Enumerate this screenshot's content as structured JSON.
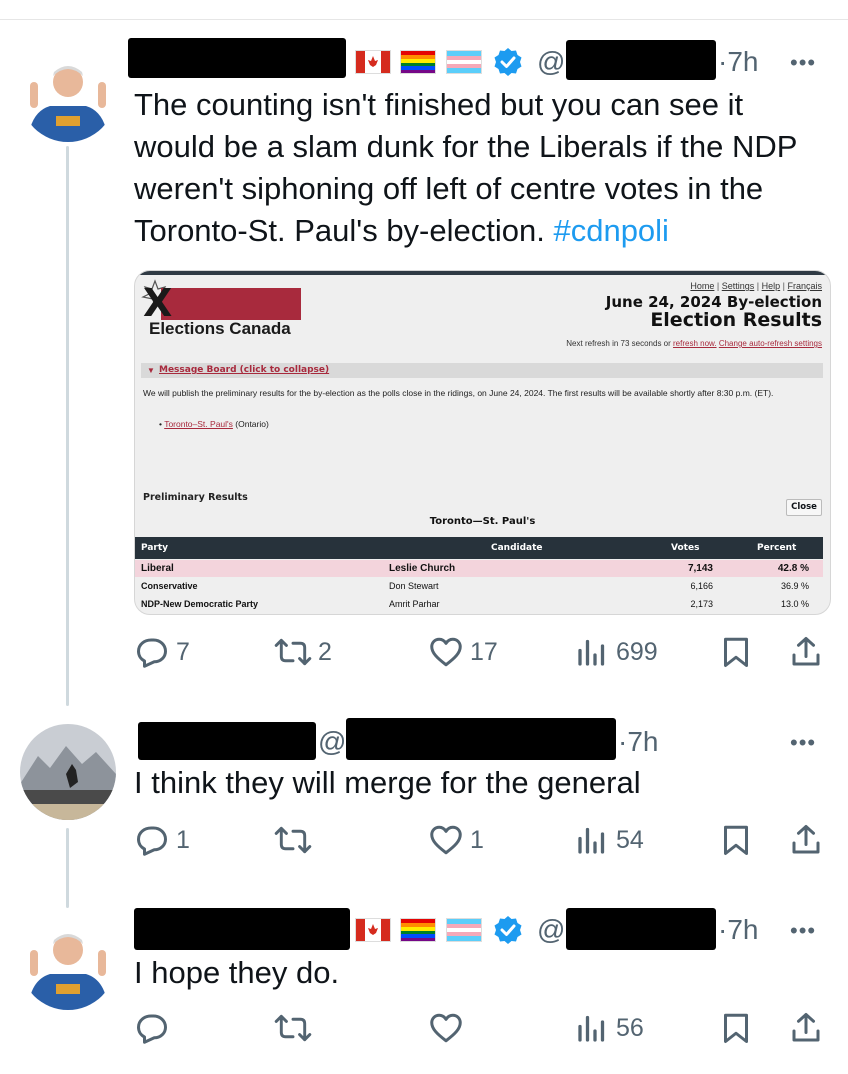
{
  "tweets": [
    {
      "time": "7h",
      "handle_prefix": "@",
      "more": "•••",
      "text_main": "The counting isn't finished but you can see it would be a slam dunk for the Liberals if the NDP weren't siphoning off left of centre votes in the Toronto-St. Paul's by-election.",
      "hashtag": "#cdnpoli",
      "replies": "7",
      "reposts": "2",
      "likes": "17",
      "views": "699"
    },
    {
      "time": "7h",
      "handle_prefix": "@",
      "more": "•••",
      "text": "I think they will merge for the general",
      "replies": "1",
      "reposts": "",
      "likes": "1",
      "views": "54"
    },
    {
      "time": "7h",
      "handle_prefix": "@",
      "more": "•••",
      "text": "I hope they do.",
      "replies": "",
      "reposts": "",
      "likes": "",
      "views": "56"
    }
  ],
  "embed": {
    "logo_text": "Elections Canada",
    "nav": [
      "Home",
      "Settings",
      "Help",
      "Français"
    ],
    "date_title": "June 24, 2024 By-election",
    "results_title": "Election Results",
    "refresh_prefix": "Next refresh in 73 seconds or",
    "refresh_now": "refresh now.",
    "refresh_change": "Change auto-refresh settings",
    "message_board": "Message Board (click to collapse)",
    "message": "We will publish the preliminary results for the by-election as the polls close in the ridings, on June 24, 2024. The first results will be available shortly after 8:30 p.m. (ET).",
    "riding_link": "Toronto–St. Paul's",
    "riding_province": "(Ontario)",
    "prelim_label": "Preliminary Results",
    "close_label": "Close",
    "riding_title": "Toronto—St. Paul's",
    "headers": {
      "party": "Party",
      "candidate": "Candidate",
      "votes": "Votes",
      "percent": "Percent"
    },
    "rows": [
      {
        "party": "Liberal",
        "candidate": "Leslie Church",
        "votes": "7,143",
        "percent": "42.8 %"
      },
      {
        "party": "Conservative",
        "candidate": "Don Stewart",
        "votes": "6,166",
        "percent": "36.9 %"
      },
      {
        "party": "NDP-New Democratic Party",
        "candidate": "Amrit Parhar",
        "votes": "2,173",
        "percent": "13.0 %"
      }
    ]
  },
  "colors": {
    "hashtag": "#1d9bf0",
    "verified": "#1d9bf0",
    "ec_red": "#a82a3d",
    "action_gray": "#536471"
  },
  "icons": [
    "reply-icon",
    "repost-icon",
    "like-icon",
    "views-icon",
    "bookmark-icon",
    "share-icon",
    "verified-icon",
    "canada-flag-icon",
    "rainbow-flag-icon",
    "trans-flag-icon"
  ]
}
